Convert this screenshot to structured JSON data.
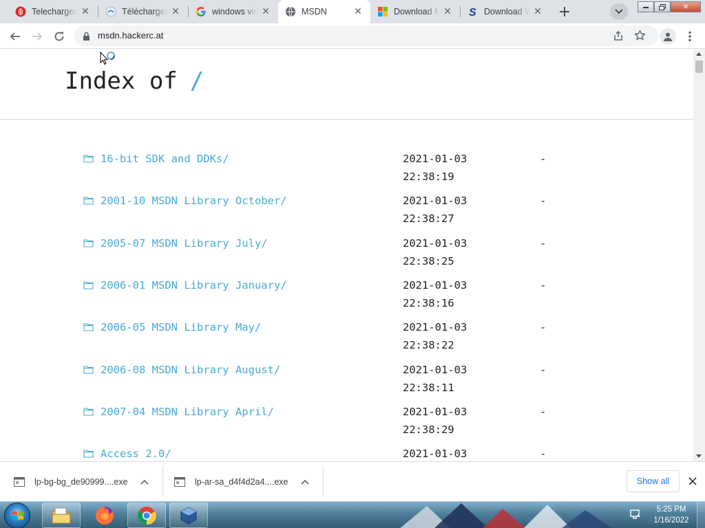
{
  "browser": {
    "tabs": [
      {
        "title": "Telecharger d",
        "favicon": "opera-icon",
        "active": false
      },
      {
        "title": "Télécharger W",
        "favicon": "site-icon",
        "active": false
      },
      {
        "title": "windows vista",
        "favicon": "google-icon",
        "active": false
      },
      {
        "title": "MSDN",
        "favicon": "globe-icon",
        "active": true
      },
      {
        "title": "Download M",
        "favicon": "microsoft-icon",
        "active": false
      },
      {
        "title": "Download W",
        "favicon": "s-logo-icon",
        "active": false
      }
    ],
    "url": "msdn.hackerc.at"
  },
  "page": {
    "heading": "Index of",
    "heading_path": "/",
    "entries": [
      {
        "name": "16-bit SDK and DDKs/",
        "date": "2021-01-03",
        "time": "22:38:19",
        "size": "-"
      },
      {
        "name": "2001-10 MSDN Library October/",
        "date": "2021-01-03",
        "time": "22:38:27",
        "size": "-"
      },
      {
        "name": "2005-07 MSDN Library July/",
        "date": "2021-01-03",
        "time": "22:38:25",
        "size": "-"
      },
      {
        "name": "2006-01 MSDN Library January/",
        "date": "2021-01-03",
        "time": "22:38:16",
        "size": "-"
      },
      {
        "name": "2006-05 MSDN Library May/",
        "date": "2021-01-03",
        "time": "22:38:22",
        "size": "-"
      },
      {
        "name": "2006-08 MSDN Library August/",
        "date": "2021-01-03",
        "time": "22:38:11",
        "size": "-"
      },
      {
        "name": "2007-04 MSDN Library April/",
        "date": "2021-01-03",
        "time": "22:38:29",
        "size": "-"
      },
      {
        "name": "Access 2.0/",
        "date": "2021-01-03",
        "time": "",
        "size": "-"
      }
    ]
  },
  "downloads": {
    "items": [
      {
        "filename": "lp-bg-bg_de90999....exe"
      },
      {
        "filename": "lp-ar-sa_d4f4d2a4....exe"
      }
    ],
    "show_all_label": "Show all"
  },
  "taskbar": {
    "time": "5:25 PM",
    "date": "1/16/2022"
  },
  "colors": {
    "link": "#47a9d6",
    "tabstrip_bg": "#dee1e6",
    "download_link": "#1a73e8"
  }
}
